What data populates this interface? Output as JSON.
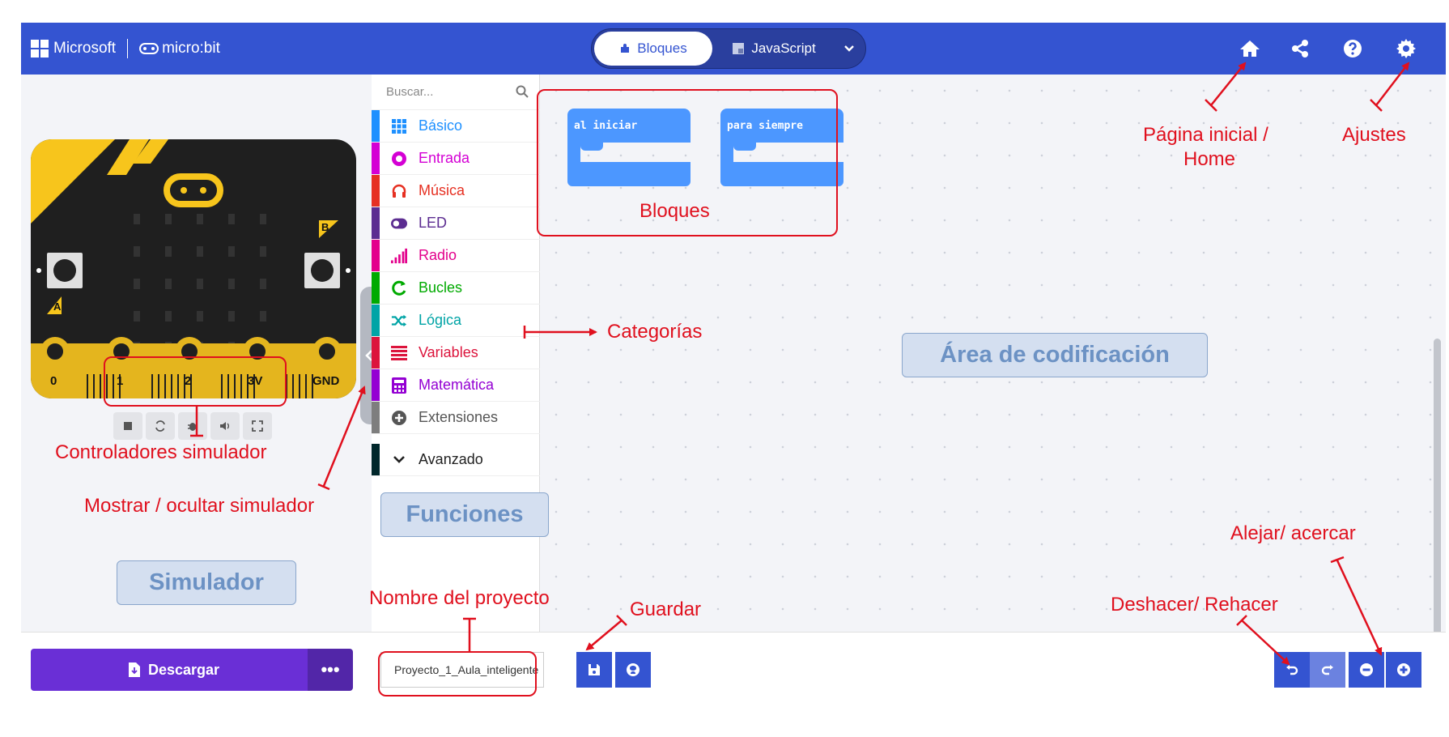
{
  "topbar": {
    "brand": "Microsoft",
    "product": "micro:bit",
    "tab_blocks": "Bloques",
    "tab_js": "JavaScript"
  },
  "simulator": {
    "pins": [
      "0",
      "1",
      "2",
      "3V",
      "GND"
    ],
    "btn_a": "A",
    "btn_b": "B"
  },
  "toolbox": {
    "search_placeholder": "Buscar...",
    "categories": [
      {
        "label": "Básico",
        "color": "#1e90ff",
        "icon": "grid-icon"
      },
      {
        "label": "Entrada",
        "color": "#d400d4",
        "icon": "circle-dot-icon"
      },
      {
        "label": "Música",
        "color": "#e63022",
        "icon": "headphones-icon"
      },
      {
        "label": "LED",
        "color": "#5c2d91",
        "icon": "toggle-icon"
      },
      {
        "label": "Radio",
        "color": "#e3008c",
        "icon": "signal-bars-icon"
      },
      {
        "label": "Bucles",
        "color": "#00aa00",
        "icon": "refresh-icon"
      },
      {
        "label": "Lógica",
        "color": "#00a4a6",
        "icon": "shuffle-icon"
      },
      {
        "label": "Variables",
        "color": "#dc143c",
        "icon": "list-icon"
      },
      {
        "label": "Matemática",
        "color": "#9400d3",
        "icon": "calculator-icon"
      },
      {
        "label": "Extensiones",
        "color": "#7e7e7e",
        "icon": "plus-circle-icon"
      }
    ],
    "advanced": {
      "label": "Avanzado",
      "color": "#00272b"
    }
  },
  "workspace": {
    "block_on_start": "al iniciar",
    "block_forever": "para siempre"
  },
  "bottombar": {
    "download_label": "Descargar",
    "more_label": "•••",
    "project_name": "Proyecto_1_Aula_inteligente"
  },
  "annotations": {
    "home": "Página inicial /",
    "home2": "Home",
    "settings": "Ajustes",
    "blocks": "Bloques",
    "categories": "Categorías",
    "coding_area": "Área de codificación",
    "sim_controls": "Controladores  simulador",
    "toggle_sim": "Mostrar / ocultar simulador",
    "functions": "Funciones",
    "simulator": "Simulador",
    "project_name": "Nombre del proyecto",
    "save": "Guardar",
    "undo_redo": "Deshacer/ Rehacer",
    "zoom": "Alejar/ acercar"
  }
}
